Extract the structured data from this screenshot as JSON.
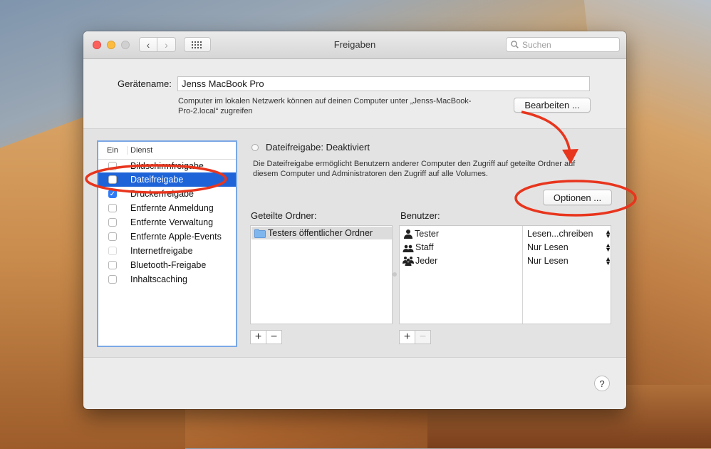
{
  "window": {
    "title": "Freigaben"
  },
  "search": {
    "placeholder": "Suchen"
  },
  "device": {
    "label": "Gerätename:",
    "name": "Jenss MacBook Pro",
    "info_line1": "Computer im lokalen Netzwerk können auf deinen Computer unter „Jenss-MacBook-",
    "info_line2": "Pro-2.local“ zugreifen",
    "edit_button": "Bearbeiten ..."
  },
  "services": {
    "header_on": "Ein",
    "header_service": "Dienst",
    "items": [
      {
        "label": "Bildschirmfreigabe",
        "checked": false
      },
      {
        "label": "Dateifreigabe",
        "checked": false,
        "selected": true
      },
      {
        "label": "Druckerfreigabe",
        "checked": true
      },
      {
        "label": "Entfernte Anmeldung",
        "checked": false
      },
      {
        "label": "Entfernte Verwaltung",
        "checked": false
      },
      {
        "label": "Entfernte Apple-Events",
        "checked": false
      },
      {
        "label": "Internetfreigabe",
        "checked": false,
        "disabled": true
      },
      {
        "label": "Bluetooth-Freigabe",
        "checked": false
      },
      {
        "label": "Inhaltscaching",
        "checked": false
      }
    ]
  },
  "detail": {
    "status": "Dateifreigabe: Deaktiviert",
    "desc_line1": "Die Dateifreigabe ermöglicht Benutzern anderer Computer den Zugriff auf geteilte Ordner auf",
    "desc_line2": "diesem Computer und Administratoren den Zugriff auf alle Volumes.",
    "options_button": "Optionen ..."
  },
  "shared_folders": {
    "label": "Geteilte Ordner:",
    "items": [
      "Testers öffentlicher Ordner"
    ]
  },
  "users": {
    "label": "Benutzer:",
    "items": [
      {
        "name": "Tester",
        "permission": "Lesen...chreiben",
        "icon": "single-user-icon"
      },
      {
        "name": "Staff",
        "permission": "Nur Lesen",
        "icon": "group-icon"
      },
      {
        "name": "Jeder",
        "permission": "Nur Lesen",
        "icon": "everyone-icon"
      }
    ]
  },
  "buttons": {
    "add": "+",
    "remove": "−",
    "help": "?"
  },
  "colors": {
    "selection": "#1e64d8",
    "annotation": "#e8351d",
    "focus_ring": "#7aa8e6"
  }
}
